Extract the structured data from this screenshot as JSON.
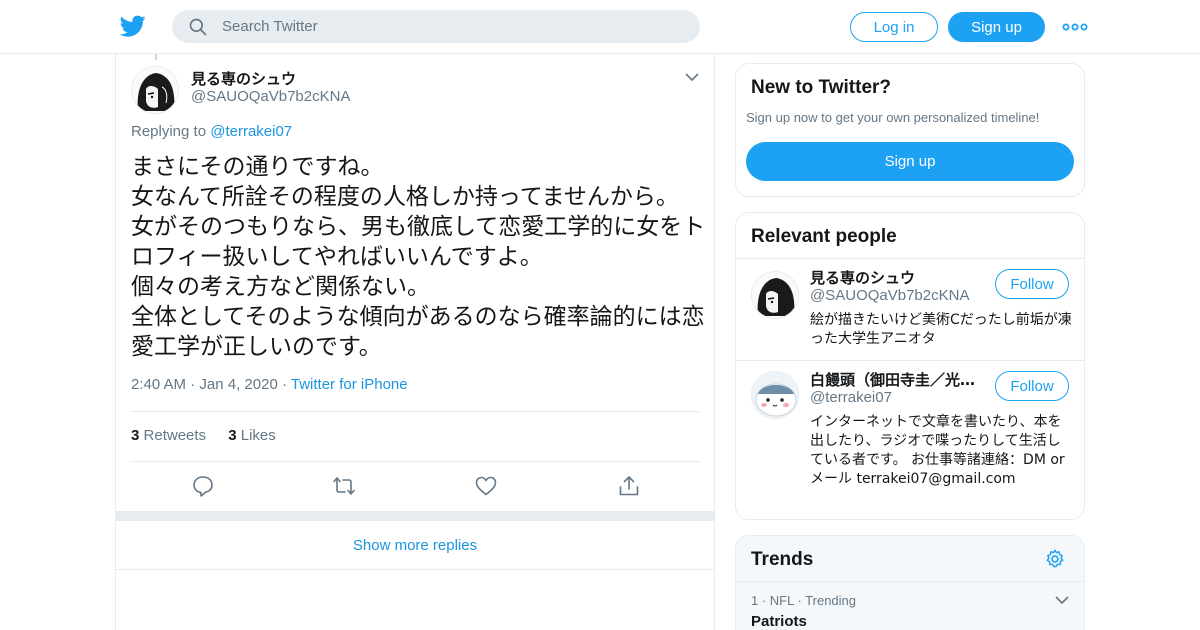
{
  "header": {
    "search_placeholder": "Search Twitter",
    "login_label": "Log in",
    "signup_label": "Sign up",
    "brand_color": "#1da1f2"
  },
  "tweet": {
    "author_name": "見る専のシュウ",
    "author_handle": "@SAUOQaVb7b2cKNA",
    "replying_prefix": "Replying to",
    "replying_to": "@terrakei07",
    "text": "まさにその通りですね。\n女なんて所詮その程度の人格しか持ってませんから。\n女がそのつもりなら、男も徹底して恋愛工学的に女をトロフィー扱いしてやればいいんですよ。\n個々の考え方など関係ない。\n全体としてそのような傾向があるのなら確率論的には恋愛工学が正しいのです。",
    "time": "2:40 AM",
    "date": "Jan 4, 2020",
    "source": "Twitter for iPhone",
    "retweets_count": "3",
    "retweets_label": "Retweets",
    "likes_count": "3",
    "likes_label": "Likes",
    "action_icons": [
      "reply-icon",
      "retweet-icon",
      "like-icon",
      "share-icon"
    ],
    "show_more_label": "Show more replies"
  },
  "sidebar": {
    "new_to_twitter": {
      "title": "New to Twitter?",
      "subtitle": "Sign up now to get your own personalized timeline!",
      "signup_label": "Sign up"
    },
    "relevant_people": {
      "title": "Relevant people",
      "people": [
        {
          "name": "見る専のシュウ",
          "handle": "@SAUOQaVb7b2cKNA",
          "bio": "絵が描きたいけど美術Cだったし前垢が凍った大学生アニオタ",
          "follow_label": "Follow"
        },
        {
          "name": "白饅頭（御田寺圭／光…",
          "handle": "@terrakei07",
          "bio": "インターネットで文章を書いたり、本を出したり、ラジオで喋ったりして生活している者です。 お仕事等諸連絡：DM or メール terrakei07@gmail.com",
          "follow_label": "Follow"
        }
      ]
    },
    "trends": {
      "title": "Trends",
      "items": [
        {
          "meta": "1 · NFL · Trending",
          "name": "Patriots"
        }
      ]
    }
  }
}
